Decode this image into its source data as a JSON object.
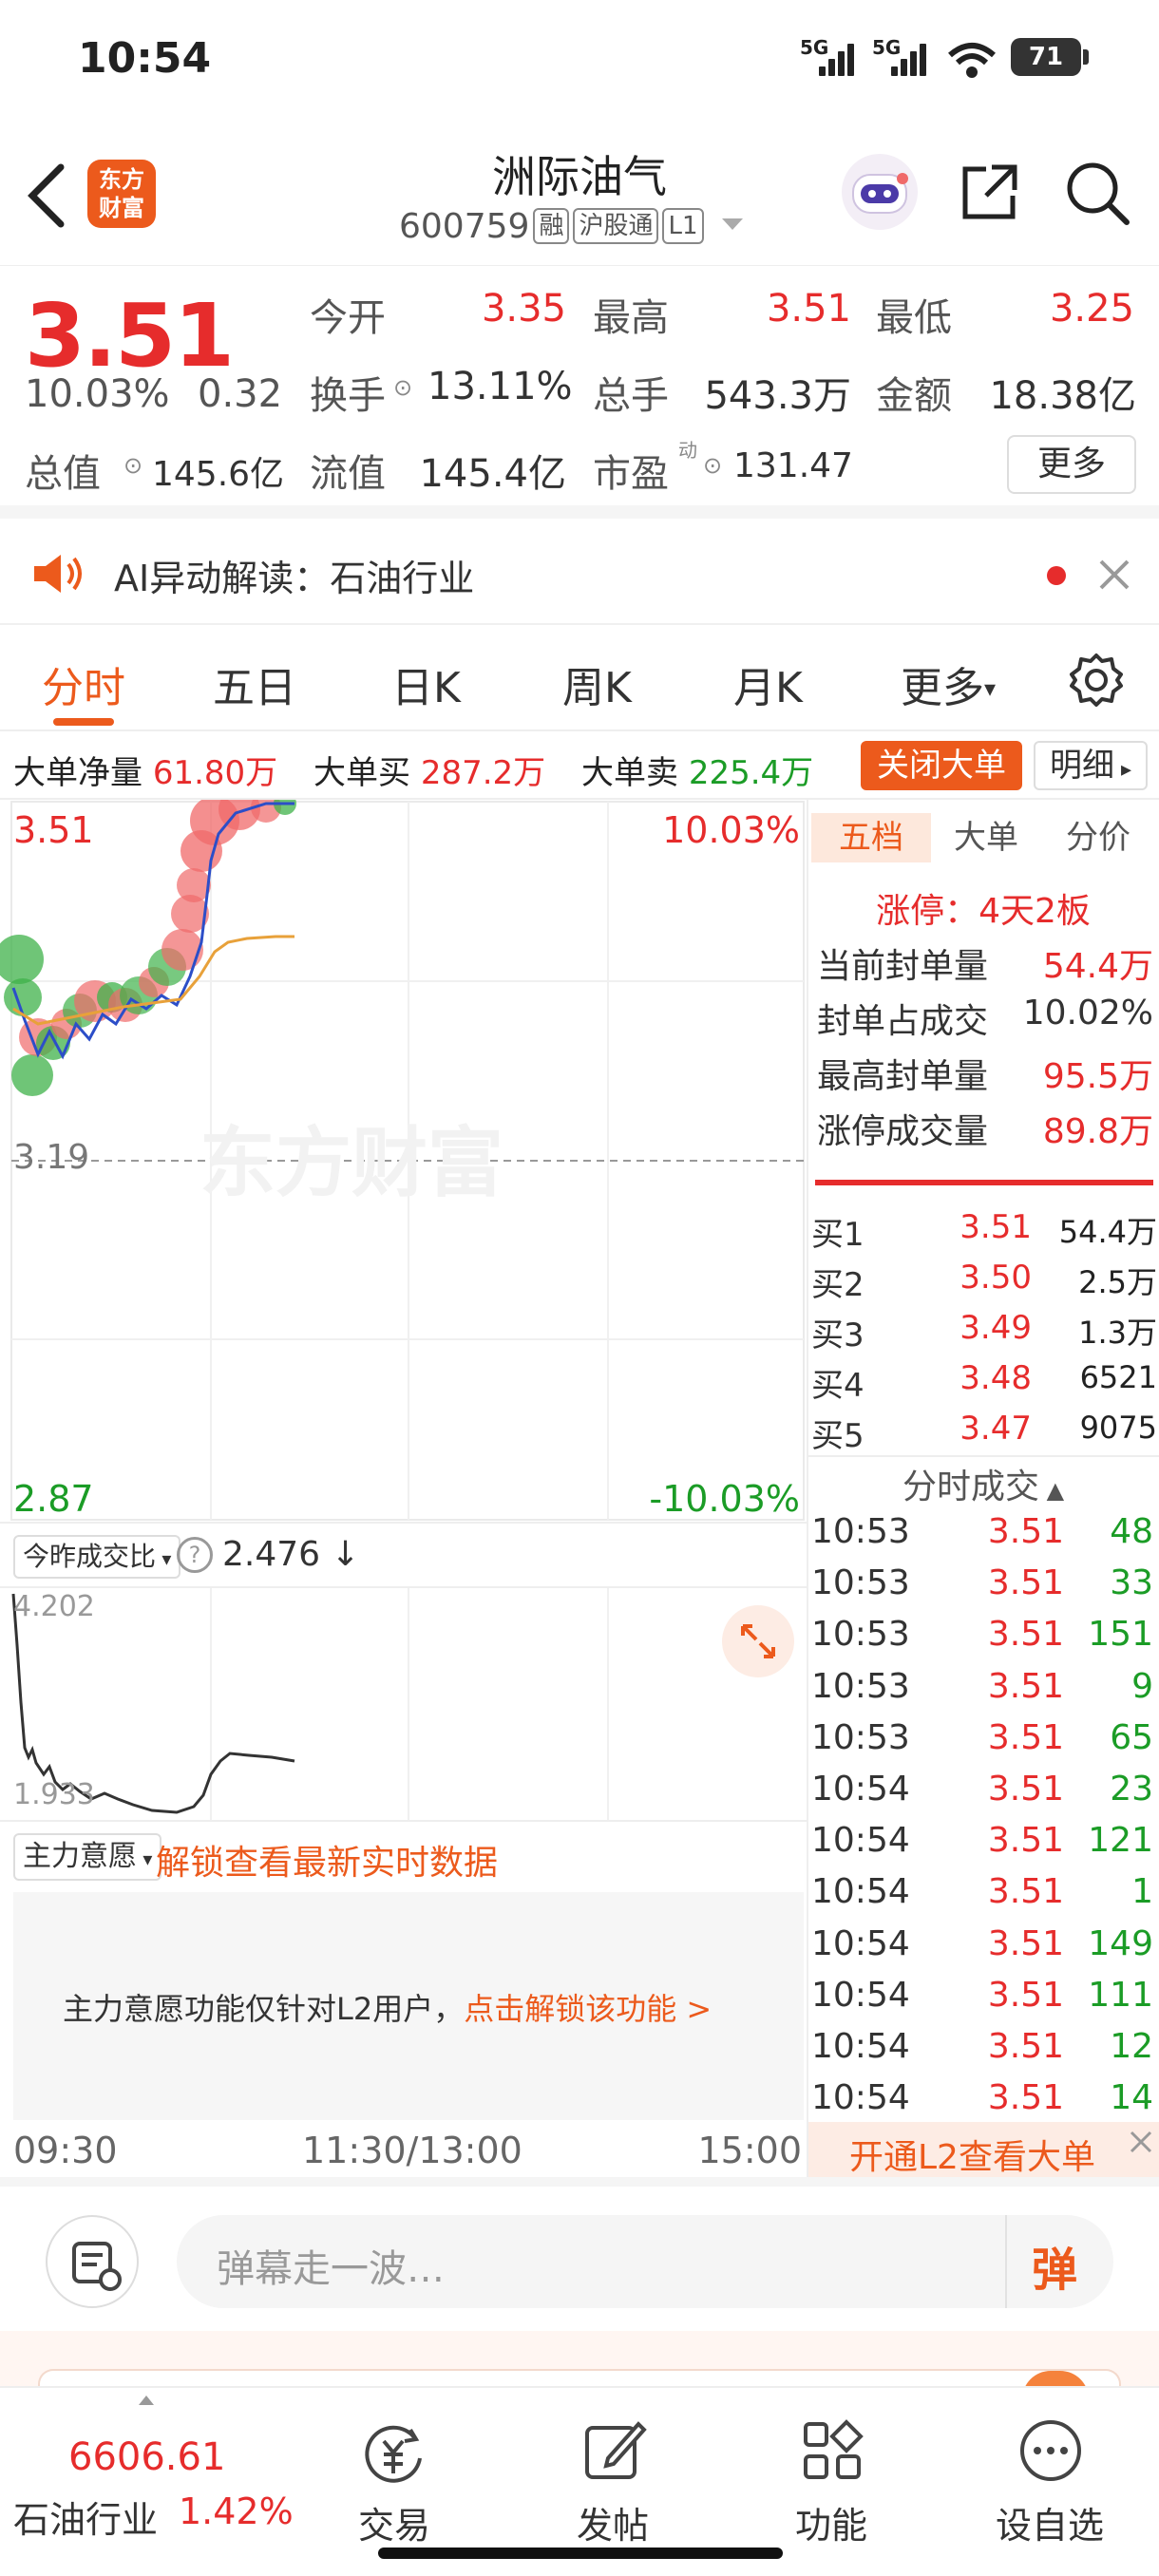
{
  "status": {
    "time": "10:54",
    "sig1": "5G",
    "sig2": "5G",
    "battery": "71"
  },
  "header": {
    "title": "洲际油气",
    "code": "600759",
    "tags": [
      "融",
      "沪股通",
      "L1"
    ],
    "logo_line1": "东方",
    "logo_line2": "财富"
  },
  "quote": {
    "price": "3.51",
    "change_pct": "10.03%",
    "change": "0.32",
    "open_label": "今开",
    "open": "3.35",
    "high_label": "最高",
    "high": "3.51",
    "low_label": "最低",
    "low": "3.25",
    "turnover_label": "换手",
    "turnover": "13.11%",
    "volume_label": "总手",
    "volume": "543.3万",
    "amount_label": "金额",
    "amount": "18.38亿",
    "mktcap_label": "总值",
    "mktcap": "145.6亿",
    "float_label": "流值",
    "float": "145.4亿",
    "pe_label": "市盈",
    "pe_sup": "动",
    "pe": "131.47",
    "more": "更多"
  },
  "ai": {
    "prefix": "AI异动解读：",
    "topic": "石油行业"
  },
  "tabs": [
    "分时",
    "五日",
    "日K",
    "周K",
    "月K",
    "更多"
  ],
  "bigorder": {
    "net_label": "大单净量",
    "net": "61.80万",
    "buy_label": "大单买",
    "buy": "287.2万",
    "sell_label": "大单卖",
    "sell": "225.4万",
    "close_btn": "关闭大单",
    "detail_btn": "明细"
  },
  "chart": {
    "top_price": "3.51",
    "top_pct": "10.03%",
    "mid_price": "3.19",
    "bottom_price": "2.87",
    "bottom_pct": "-10.03%",
    "watermark": "东方财富",
    "ratio_label": "今昨成交比",
    "ratio_value": "2.476",
    "ratio_max": "4.202",
    "ratio_min": "1.933",
    "main_label": "主力意愿",
    "unlock_text": "解锁查看最新实时数据",
    "l2_notice": "主力意愿功能仅针对L2用户，",
    "l2_link": "点击解锁该功能 >",
    "time_start": "09:30",
    "time_mid": "11:30/13:00",
    "time_end": "15:00"
  },
  "right": {
    "tabs": [
      "五档",
      "大单",
      "分价"
    ],
    "limit_title": "涨停：4天2板",
    "limit_rows": [
      {
        "label": "当前封单量",
        "value": "54.4万"
      },
      {
        "label": "封单占成交",
        "value": "10.02%"
      },
      {
        "label": "最高封单量",
        "value": "95.5万"
      },
      {
        "label": "涨停成交量",
        "value": "89.8万"
      }
    ],
    "bids": [
      {
        "label": "买1",
        "price": "3.51",
        "vol": "54.4万"
      },
      {
        "label": "买2",
        "price": "3.50",
        "vol": "2.5万"
      },
      {
        "label": "买3",
        "price": "3.49",
        "vol": "1.3万"
      },
      {
        "label": "买4",
        "price": "3.48",
        "vol": "6521"
      },
      {
        "label": "买5",
        "price": "3.47",
        "vol": "9075"
      }
    ],
    "ticks_title": "分时成交",
    "ticks": [
      {
        "time": "10:53",
        "price": "3.51",
        "vol": "48"
      },
      {
        "time": "10:53",
        "price": "3.51",
        "vol": "33"
      },
      {
        "time": "10:53",
        "price": "3.51",
        "vol": "151"
      },
      {
        "time": "10:53",
        "price": "3.51",
        "vol": "9"
      },
      {
        "time": "10:53",
        "price": "3.51",
        "vol": "65"
      },
      {
        "time": "10:54",
        "price": "3.51",
        "vol": "23"
      },
      {
        "time": "10:54",
        "price": "3.51",
        "vol": "121"
      },
      {
        "time": "10:54",
        "price": "3.51",
        "vol": "1"
      },
      {
        "time": "10:54",
        "price": "3.51",
        "vol": "149"
      },
      {
        "time": "10:54",
        "price": "3.51",
        "vol": "111"
      },
      {
        "time": "10:54",
        "price": "3.51",
        "vol": "12"
      },
      {
        "time": "10:54",
        "price": "3.51",
        "vol": "14"
      }
    ],
    "l2_banner": "开通L2查看大单"
  },
  "comment": {
    "placeholder": "弹幕走一波…",
    "danmu_btn": "弹"
  },
  "nav": {
    "index_value": "6606.61",
    "index_name": "石油行业",
    "index_pct": "1.42%",
    "items": [
      "交易",
      "发帖",
      "功能",
      "设自选"
    ]
  },
  "colors": {
    "up": "#e62c2c",
    "down": "#1b9c26",
    "brand": "#ec5a1c"
  }
}
